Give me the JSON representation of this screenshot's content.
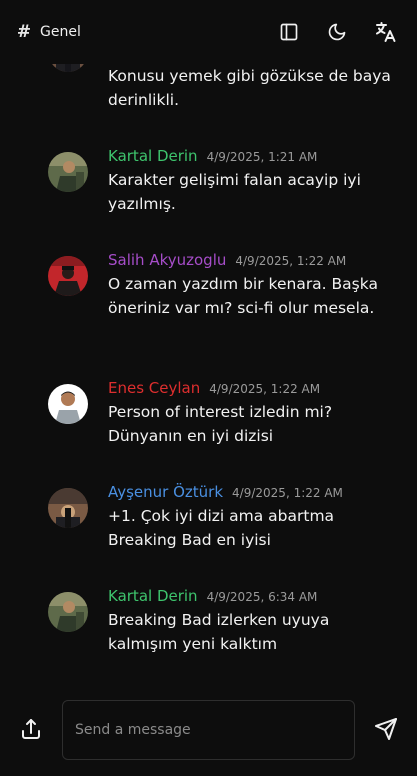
{
  "header": {
    "channel_name": "Genel"
  },
  "messages": [
    {
      "author": "",
      "time": "",
      "text": "Konusu yemek gibi gözükse de baya derinlikli.",
      "author_color": "#3ec46d",
      "avatar": "avatar-photo"
    },
    {
      "author": "Kartal Derin",
      "time": "4/9/2025, 1:21 AM",
      "text": "Karakter gelişimi falan acayip iyi yazılmış.",
      "author_color": "#3ec46d",
      "avatar": "avatar-photo"
    },
    {
      "author": "Salih Akyuzoglu",
      "time": "4/9/2025, 1:22 AM",
      "text": "O zaman yazdım bir kenara. Başka öneriniz var mı? sci-fi olur mesela.",
      "author_color": "#a64dc9",
      "avatar": "avatar-photo"
    },
    {
      "author": "Enes Ceylan",
      "time": "4/9/2025, 1:22 AM",
      "text": "Person of interest izledin mi? Dünyanın en iyi dizisi",
      "author_color": "#dd2e2e",
      "avatar": "avatar-photo"
    },
    {
      "author": "Ayşenur Öztürk",
      "time": "4/9/2025, 1:22 AM",
      "text": "+1. Çok iyi dizi ama abartma Breaking Bad en iyisi",
      "author_color": "#4a90e2",
      "avatar": "avatar-photo"
    },
    {
      "author": "Kartal Derin",
      "time": "4/9/2025, 6:34 AM",
      "text": "Breaking Bad izlerken uyuya kalmışım yeni kalktım",
      "author_color": "#3ec46d",
      "avatar": "avatar-photo"
    }
  ],
  "composer": {
    "placeholder": "Send a message"
  },
  "icons": {
    "channel": "hash-icon",
    "sidebar_toggle": "sidebar-toggle-icon",
    "theme": "moon-icon",
    "language": "translate-icon",
    "upload": "upload-icon",
    "send": "send-icon"
  }
}
